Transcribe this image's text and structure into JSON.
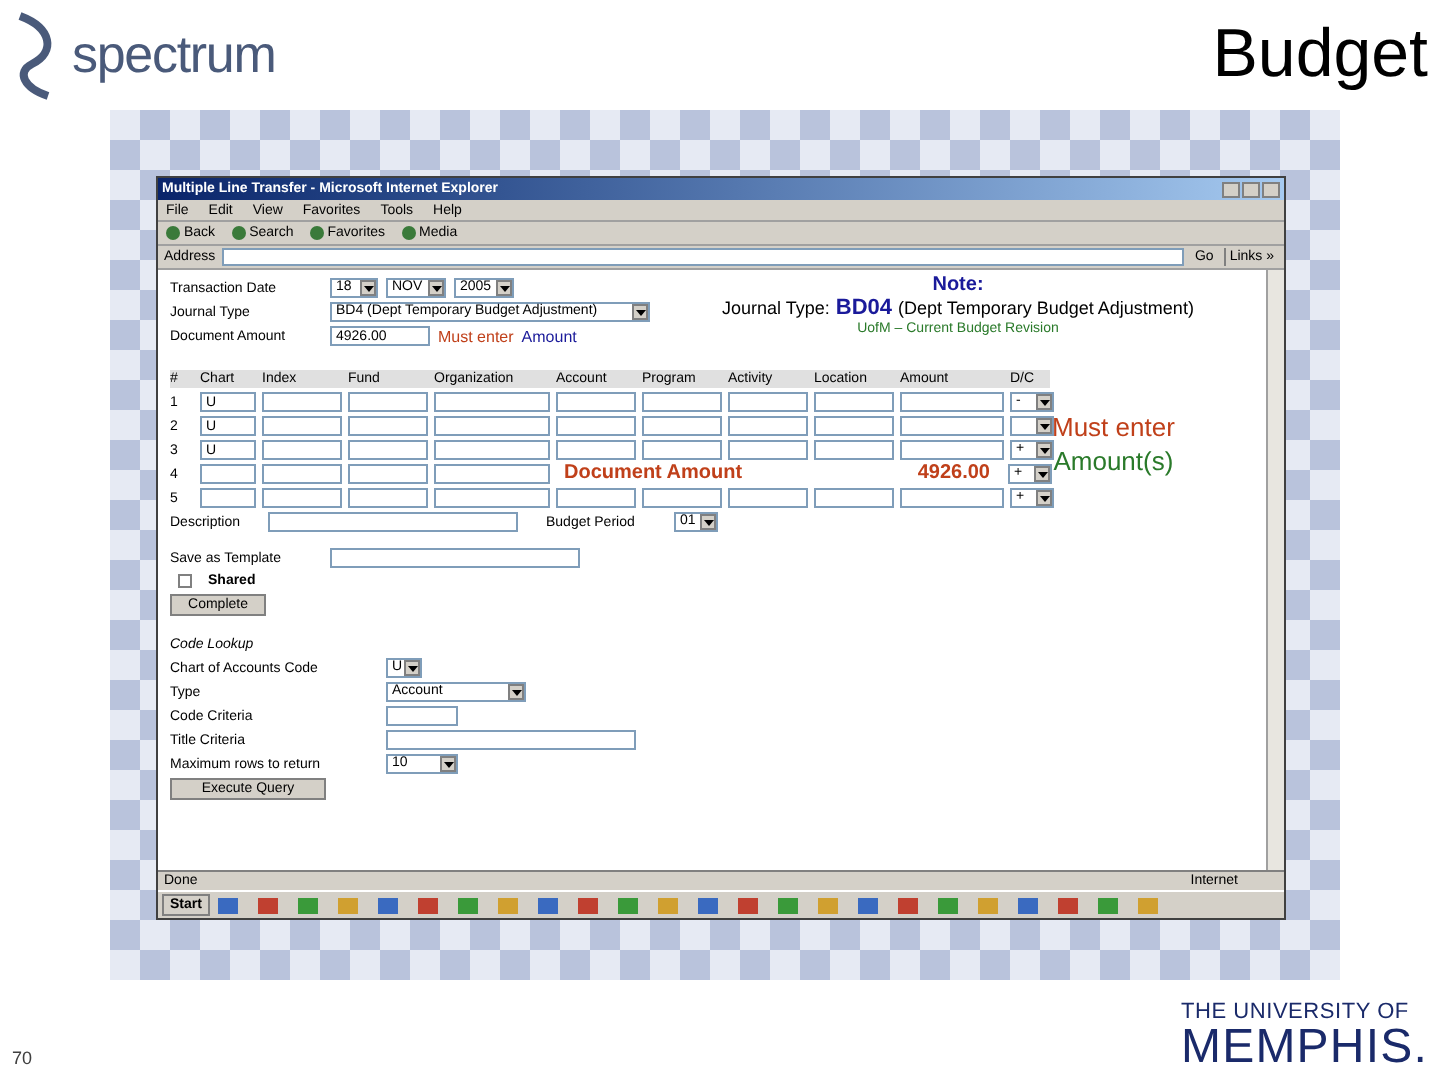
{
  "slide": {
    "title": "Budget",
    "logo_text": "spectrum",
    "page_number": "70",
    "university_line1": "THE UNIVERSITY OF",
    "university_line2": "MEMPHIS."
  },
  "browser": {
    "title": "Multiple Line Transfer - Microsoft Internet Explorer",
    "menu": [
      "File",
      "Edit",
      "View",
      "Favorites",
      "Tools",
      "Help"
    ],
    "toolbar": [
      "Back",
      "Search",
      "Favorites",
      "Media"
    ],
    "address_label": "Address",
    "go": "Go",
    "links": "Links »",
    "status": "Done",
    "zone": "Internet",
    "start": "Start"
  },
  "form": {
    "transaction_date_label": "Transaction Date",
    "day": "18",
    "month": "NOV",
    "year": "2005",
    "journal_type_label": "Journal Type",
    "journal_type": "BD4 (Dept Temporary Budget Adjustment)",
    "document_amount_label": "Document Amount",
    "document_amount": "4926.00",
    "must_enter": "Must enter",
    "amount_word": "Amount",
    "columns": [
      "#",
      "Chart",
      "Index",
      "Fund",
      "Organization",
      "Account",
      "Program",
      "Activity",
      "Location",
      "Amount",
      "D/C"
    ],
    "rows": [
      {
        "number": "1",
        "chart": "U",
        "dc": "-"
      },
      {
        "number": "2",
        "chart": "U",
        "dc": ""
      },
      {
        "number": "3",
        "chart": "U",
        "dc": "+"
      },
      {
        "number": "4",
        "chart": "",
        "dc": "+",
        "note_label": "Document Amount",
        "note_value": "4926.00"
      },
      {
        "number": "5",
        "chart": "",
        "dc": "+"
      }
    ],
    "description_label": "Description",
    "budget_period_label": "Budget Period",
    "budget_period": "01",
    "save_template_label": "Save as Template",
    "shared_label": "Shared",
    "shared_checked": false,
    "complete": "Complete",
    "code_lookup": "Code Lookup",
    "chart_code_label": "Chart of Accounts Code",
    "chart_code": "U",
    "type_label": "Type",
    "type_value": "Account",
    "code_criteria_label": "Code Criteria",
    "title_criteria_label": "Title Criteria",
    "max_rows_label": "Maximum rows to return",
    "max_rows": "10",
    "execute": "Execute Query"
  },
  "callouts": {
    "note_title": "Note:",
    "note_prefix": "Journal Type:",
    "note_code": "BD04",
    "note_desc": "(Dept Temporary Budget Adjustment)",
    "note_sub": "UofM – Current Budget Revision",
    "must_line1": "Must enter",
    "must_line2": "Amount(s)"
  }
}
